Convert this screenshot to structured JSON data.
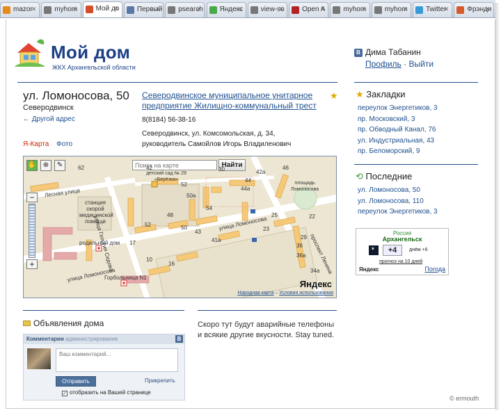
{
  "tabs": [
    {
      "label": "mazor",
      "color": "#e68a1a",
      "active": false
    },
    {
      "label": "myhom",
      "color": "#777777",
      "active": false
    },
    {
      "label": "Мой до",
      "color": "#d44d2a",
      "active": true
    },
    {
      "label": "Первый",
      "color": "#5a77a6",
      "active": false
    },
    {
      "label": "psearch",
      "color": "#777777",
      "active": false
    },
    {
      "label": "Яндекс",
      "color": "#4aa84a",
      "active": false
    },
    {
      "label": "view-so",
      "color": "#777777",
      "active": false
    },
    {
      "label": "Open A",
      "color": "#b32323",
      "active": false
    },
    {
      "label": "myhom",
      "color": "#777777",
      "active": false
    },
    {
      "label": "myhom",
      "color": "#777777",
      "active": false
    },
    {
      "label": "Twitter",
      "color": "#3a9ad9",
      "active": false
    },
    {
      "label": "Фрэнди",
      "color": "#d85a2a",
      "active": false
    }
  ],
  "site": {
    "title": "Мой дом",
    "subtitle": "ЖКХ Архангельской области"
  },
  "user": {
    "badge": "В",
    "name": "Дима Табанин",
    "profile": "Профиль",
    "sep": "·",
    "logout": "Выйти"
  },
  "house": {
    "address": "ул. Ломоносова, 50",
    "city": "Северодвинск",
    "other": "← Другой адрес"
  },
  "org": {
    "name": "Северодвинское муниципальное унитарное предприятие Жилищно-коммунальный трест",
    "phone": "8(8184) 56-38-16",
    "address": "Северодвинск, ул. Комсомольская, д. 34,",
    "head": "руководитель Самойлов Игорь Владиленович"
  },
  "map_tabs": {
    "yandex": "Я-Карта",
    "photo": "Фото"
  },
  "map": {
    "search_placeholder": "Поиск на карте",
    "find_button": "Найти",
    "labels": {
      "lesnaya": "Лесная улица",
      "ambulance": "станция скорой медицинской помощи",
      "kindergarten": "детский сад № 29 «Берёзка»",
      "square": "площадь Ломоносова",
      "georgiy": "улица Георгия Седова",
      "maternity": "родильный дом",
      "hospital": "Горбольница N1",
      "lomonosova_st": "улица Ломоносова",
      "lomonosova_st2": "улица Ломоносова",
      "lenina": "проспект Ленина"
    },
    "numbers": [
      "62",
      "42",
      "30",
      "52",
      "46",
      "44",
      "42а",
      "44а",
      "50а",
      "50",
      "54",
      "52",
      "48",
      "43",
      "41а",
      "25",
      "22",
      "16",
      "10",
      "17",
      "29",
      "23",
      "36",
      "36а",
      "34а"
    ],
    "brand": "Яндекс",
    "footer": {
      "map_link": "Народная карта",
      "sep": "–",
      "terms": "Условия использования"
    }
  },
  "bookmarks": {
    "title": "Закладки",
    "items": [
      "переулок Энергетиков, 3",
      "пр. Московский, 3",
      "пр. Обводный Канал, 76",
      "ул. Индустриальная, 43",
      "пр. Беломорский, 9"
    ]
  },
  "recent": {
    "title": "Последние",
    "items": [
      "ул. Ломоносова, 50",
      "ул. Ломоносова, 110",
      "переулок Энергетиков, 3"
    ]
  },
  "weather": {
    "country": "Россия",
    "city": "Архангельск",
    "temp": "+4",
    "day": "днём +6",
    "forecast": "прогноз на 10 дней",
    "brand": "Яндекс",
    "link": "Погода"
  },
  "announcements": {
    "title": "Объявления дома"
  },
  "vk_widget": {
    "tab_comments": "Комментарии",
    "tab_admin": "администрирование",
    "badge": "В",
    "placeholder": "Ваш комментарий...",
    "send": "Отправить",
    "attach": "Прикрепить",
    "checkbox": "отобразить на Вашей странице"
  },
  "soon_text": "Скоро тут будут аварийные телефоны и всякие другие вкусности. Stay tuned.",
  "credit": "© ermouth",
  "colors": {
    "brand_blue": "#1c3f86",
    "link": "#1f4f8f",
    "accent_red": "#cc2200"
  }
}
